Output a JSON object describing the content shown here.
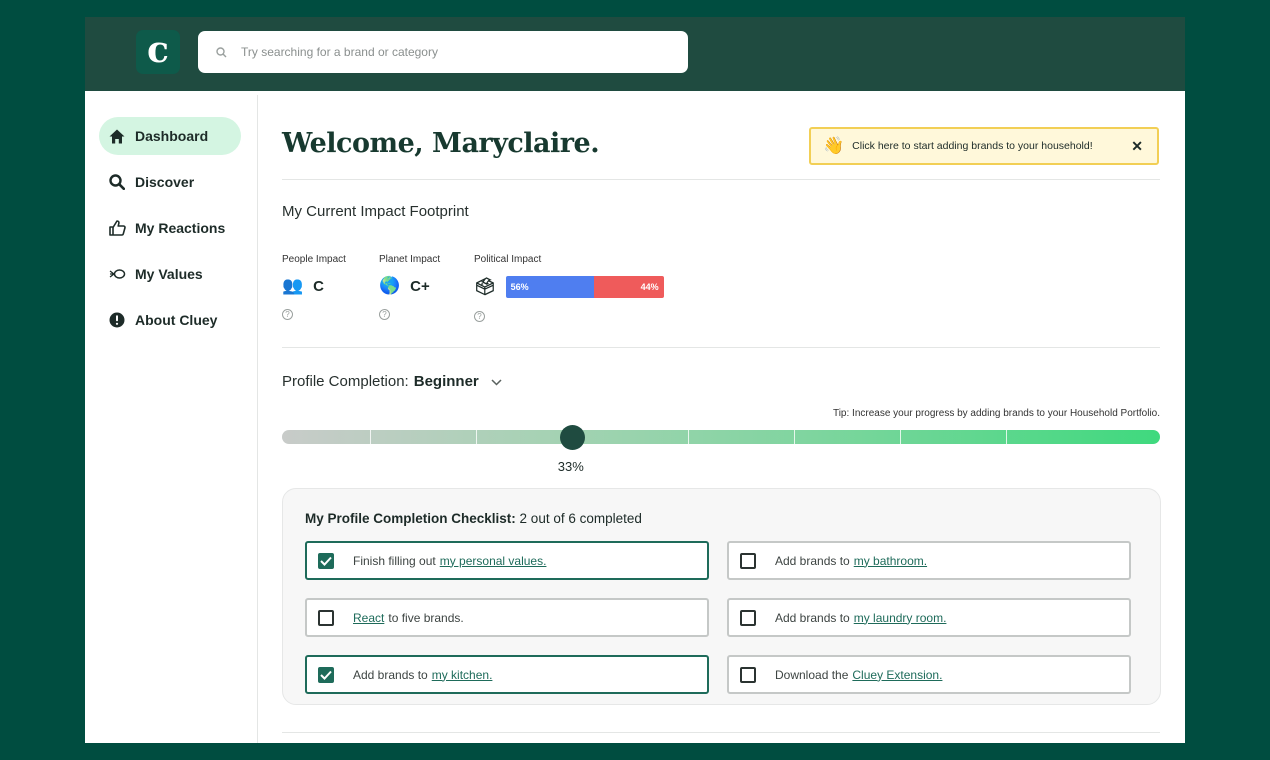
{
  "app": {
    "logo_letter": "c"
  },
  "search": {
    "placeholder": "Try searching for a brand or category"
  },
  "sidebar": {
    "items": [
      {
        "label": "Dashboard",
        "icon": "home-icon",
        "active": true
      },
      {
        "label": "Discover",
        "icon": "search-icon"
      },
      {
        "label": "My Reactions",
        "icon": "thumbs-up-icon"
      },
      {
        "label": "My Values",
        "icon": "values-icon"
      },
      {
        "label": "About Cluey",
        "icon": "info-icon"
      }
    ]
  },
  "main": {
    "welcome": "Welcome, Maryclaire.",
    "toast": {
      "emoji": "👋",
      "text": "Click here to start adding brands to your household!",
      "close": "✕"
    },
    "footprint": {
      "title": "My Current Impact Footprint",
      "people": {
        "label": "People Impact",
        "emoji": "👥",
        "grade": "C",
        "help": "?"
      },
      "planet": {
        "label": "Planet Impact",
        "emoji": "🌎",
        "grade": "C+",
        "help": "?"
      },
      "political": {
        "label": "Political Impact",
        "emoji": "🗳",
        "left_pct": 56,
        "right_pct": 44,
        "left_label": "56%",
        "right_label": "44%",
        "help": "?"
      }
    },
    "profile": {
      "label": "Profile Completion:",
      "level": "Beginner",
      "tip": "Tip: Increase your progress by adding brands to your Household Portfolio.",
      "progress": 0.33,
      "progress_label": "33%"
    },
    "checklist": {
      "title": "My Profile Completion Checklist:",
      "summary": "2 out of 6 completed",
      "tasks": [
        {
          "checked": true,
          "text": "Finish filling out",
          "link": "my personal values."
        },
        {
          "checked": false,
          "text": "Add brands to",
          "link": "my bathroom."
        },
        {
          "checked": false,
          "link": "React",
          "text": "to five brands."
        },
        {
          "checked": false,
          "text": "Add brands to",
          "link": "my laundry room."
        },
        {
          "checked": true,
          "text": "Add brands to",
          "link": "my kitchen."
        },
        {
          "checked": false,
          "text": "Download the",
          "link": "Cluey Extension."
        }
      ]
    }
  },
  "colors": {
    "accent": "#1e6b5a",
    "header": "#1f4b40",
    "background": "#004d40",
    "active_nav": "#d4f5e2",
    "toast_border": "#f2cf55"
  }
}
